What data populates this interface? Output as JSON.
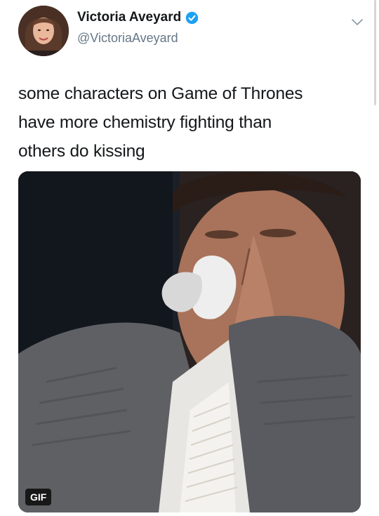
{
  "user": {
    "display_name": "Victoria Aveyard",
    "handle": "@VictoriaAveyard",
    "verified": true
  },
  "tweet": {
    "text_lines": [
      "some characters on Game of Thrones",
      "have more chemistry fighting than",
      "others do kissing"
    ]
  },
  "media": {
    "badge": "GIF"
  },
  "icons": {
    "verified": "verified-badge-icon",
    "menu": "chevron-down-icon"
  },
  "colors": {
    "verified_blue": "#1da1f2",
    "handle_gray": "#657786",
    "text": "#14171a"
  }
}
